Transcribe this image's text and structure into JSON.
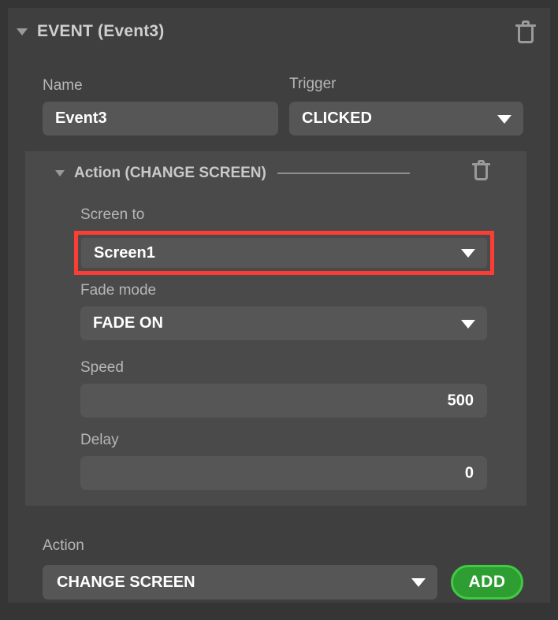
{
  "event": {
    "title": "EVENT (Event3)",
    "collapse_icon": "triangle-down-icon",
    "delete_icon": "trash-icon",
    "name": {
      "label": "Name",
      "value": "Event3"
    },
    "trigger": {
      "label": "Trigger",
      "value": "CLICKED",
      "caret_icon": "caret-down-icon"
    }
  },
  "action_block": {
    "title": "Action (CHANGE SCREEN)",
    "collapse_icon": "triangle-down-icon",
    "delete_icon": "trash-icon",
    "screen_to": {
      "label": "Screen to",
      "value": "Screen1",
      "caret_icon": "caret-down-icon",
      "highlight_color": "#fc3d34"
    },
    "fade_mode": {
      "label": "Fade mode",
      "value": "FADE ON",
      "caret_icon": "caret-down-icon"
    },
    "speed": {
      "label": "Speed",
      "value": "500"
    },
    "delay": {
      "label": "Delay",
      "value": "0"
    }
  },
  "footer": {
    "action": {
      "label": "Action",
      "value": "CHANGE SCREEN",
      "caret_icon": "caret-down-icon"
    },
    "add_button": {
      "label": "ADD",
      "color": "#2e9e33",
      "border_color": "#3fcb42"
    }
  }
}
